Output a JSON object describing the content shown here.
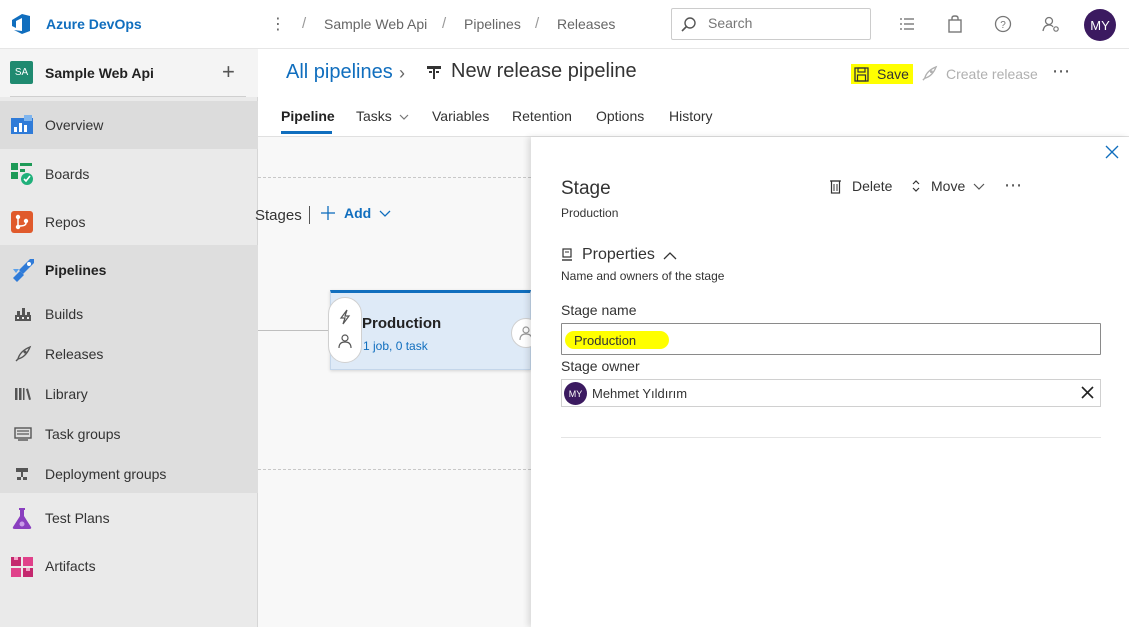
{
  "brand": {
    "name": "Azure DevOps"
  },
  "breadcrumb": [
    "Sample Web Api",
    "Pipelines",
    "Releases"
  ],
  "search": {
    "placeholder": "Search"
  },
  "user": {
    "initials": "MY"
  },
  "project": {
    "badge": "SA",
    "name": "Sample Web Api"
  },
  "sidebar": {
    "items": [
      {
        "label": "Overview"
      },
      {
        "label": "Boards"
      },
      {
        "label": "Repos"
      },
      {
        "label": "Pipelines"
      },
      {
        "label": "Builds"
      },
      {
        "label": "Releases"
      },
      {
        "label": "Library"
      },
      {
        "label": "Task groups"
      },
      {
        "label": "Deployment groups"
      },
      {
        "label": "Test Plans"
      },
      {
        "label": "Artifacts"
      }
    ]
  },
  "header": {
    "back_label": "All pipelines",
    "title": "New release pipeline",
    "save_label": "Save",
    "create_release_label": "Create release",
    "tabs": [
      "Pipeline",
      "Tasks",
      "Variables",
      "Retention",
      "Options",
      "History"
    ]
  },
  "canvas": {
    "stages_label": "Stages",
    "add_label": "Add",
    "stage": {
      "name": "Production",
      "summary": "1 job, 0 task"
    }
  },
  "panel": {
    "title": "Stage",
    "subtitle": "Production",
    "delete_label": "Delete",
    "move_label": "Move",
    "properties_title": "Properties",
    "properties_desc": "Name and owners of the stage",
    "stage_name_label": "Stage name",
    "stage_name_value": "Production",
    "stage_owner_label": "Stage owner",
    "owner_initials": "MY",
    "owner_name": "Mehmet Yıldırım"
  },
  "colors": {
    "accent": "#106ebe",
    "highlight": "#ffff00",
    "avatar": "#3b1a60"
  }
}
